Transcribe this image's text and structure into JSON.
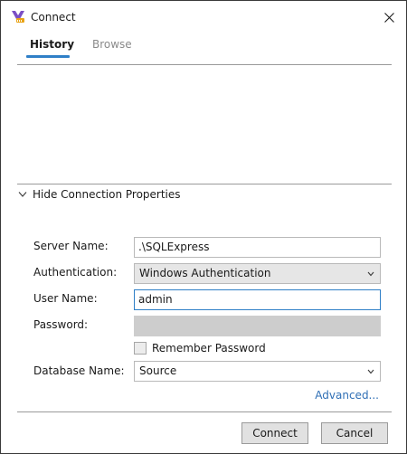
{
  "window": {
    "title": "Connect"
  },
  "tabs": [
    {
      "label": "History",
      "active": true
    },
    {
      "label": "Browse",
      "active": false
    }
  ],
  "connection_toggle": {
    "label": "Hide Connection Properties"
  },
  "form": {
    "server_name": {
      "label": "Server Name:",
      "value": ".\\SQLExpress"
    },
    "authentication": {
      "label": "Authentication:",
      "value": "Windows Authentication"
    },
    "user_name": {
      "label": "User Name:",
      "value": "admin"
    },
    "password": {
      "label": "Password:",
      "value": ""
    },
    "remember_password": {
      "label": "Remember Password",
      "checked": false
    },
    "database_name": {
      "label": "Database Name:",
      "value": "Source"
    }
  },
  "advanced_link": "Advanced...",
  "buttons": {
    "connect": "Connect",
    "cancel": "Cancel"
  },
  "icons": {
    "app": "app-logo-icon",
    "close": "close-icon",
    "toggle": "chevron-down-icon",
    "dropdown": "chevron-down-icon"
  },
  "colors": {
    "accent": "#2f7fc7",
    "link": "#2f6fb5"
  }
}
